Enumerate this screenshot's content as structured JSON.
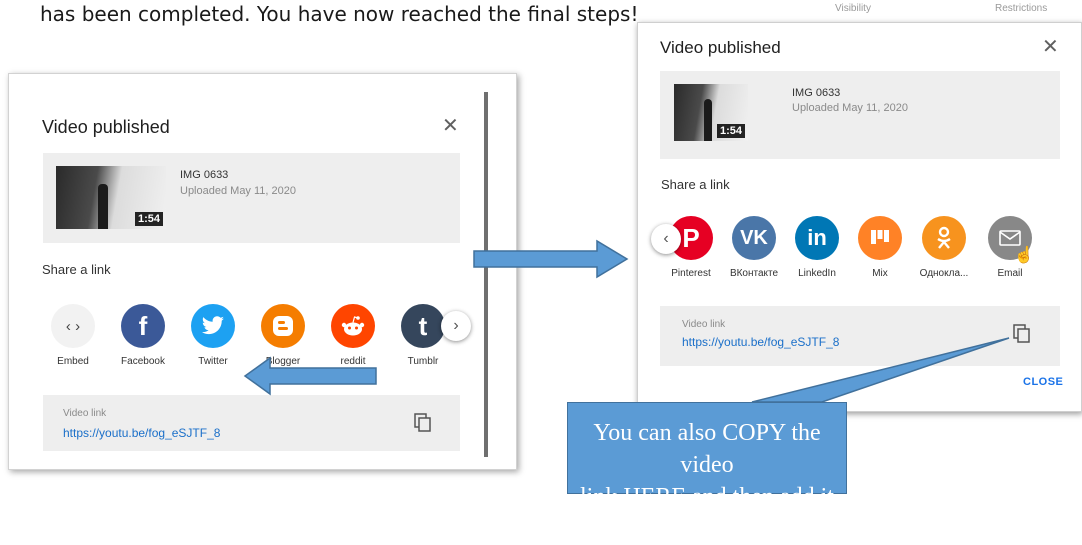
{
  "instruction_text": "has been completed. You have now reached the final steps!",
  "background_header": {
    "visibility": "Visibility",
    "restrictions": "Restrictions"
  },
  "left_dialog": {
    "title": "Video published",
    "video": {
      "title": "IMG 0633",
      "uploaded": "Uploaded May 11, 2020",
      "duration": "1:54"
    },
    "share_label": "Share a link",
    "share_items": [
      {
        "label": "Embed",
        "icon": "code-icon",
        "color": "#f2f2f2"
      },
      {
        "label": "Facebook",
        "icon": "facebook-icon",
        "color": "#3b5998"
      },
      {
        "label": "Twitter",
        "icon": "twitter-icon",
        "color": "#1da1f2"
      },
      {
        "label": "Blogger",
        "icon": "blogger-icon",
        "color": "#f57d00"
      },
      {
        "label": "reddit",
        "icon": "reddit-icon",
        "color": "#ff4500"
      },
      {
        "label": "Tumblr",
        "icon": "tumblr-icon",
        "color": "#35465c"
      }
    ],
    "link": {
      "label": "Video link",
      "url": "https://youtu.be/fog_eSJTF_8"
    }
  },
  "right_dialog": {
    "title": "Video published",
    "video": {
      "title": "IMG 0633",
      "uploaded": "Uploaded May 11, 2020",
      "duration": "1:54"
    },
    "share_label": "Share a link",
    "share_items": [
      {
        "label": "Pinterest",
        "icon": "pinterest-icon",
        "color": "#e60023"
      },
      {
        "label": "ВКонтакте",
        "icon": "vk-icon",
        "color": "#4a76a8"
      },
      {
        "label": "LinkedIn",
        "icon": "linkedin-icon",
        "color": "#0077b5"
      },
      {
        "label": "Mix",
        "icon": "mix-icon",
        "color": "#ff8226"
      },
      {
        "label": "Однокла...",
        "icon": "odnoklassniki-icon",
        "color": "#f7931e"
      },
      {
        "label": "Email",
        "icon": "email-icon",
        "color": "#888888"
      }
    ],
    "link": {
      "label": "Video link",
      "url": "https://youtu.be/fog_eSJTF_8"
    },
    "close_label": "CLOSE"
  },
  "callout": {
    "line1": "You can also COPY the video",
    "line2": "link HERE and then add it in a"
  },
  "colors": {
    "arrow_fill": "#5b9bd5",
    "arrow_stroke": "#41719c",
    "link": "#1a6fc9"
  }
}
